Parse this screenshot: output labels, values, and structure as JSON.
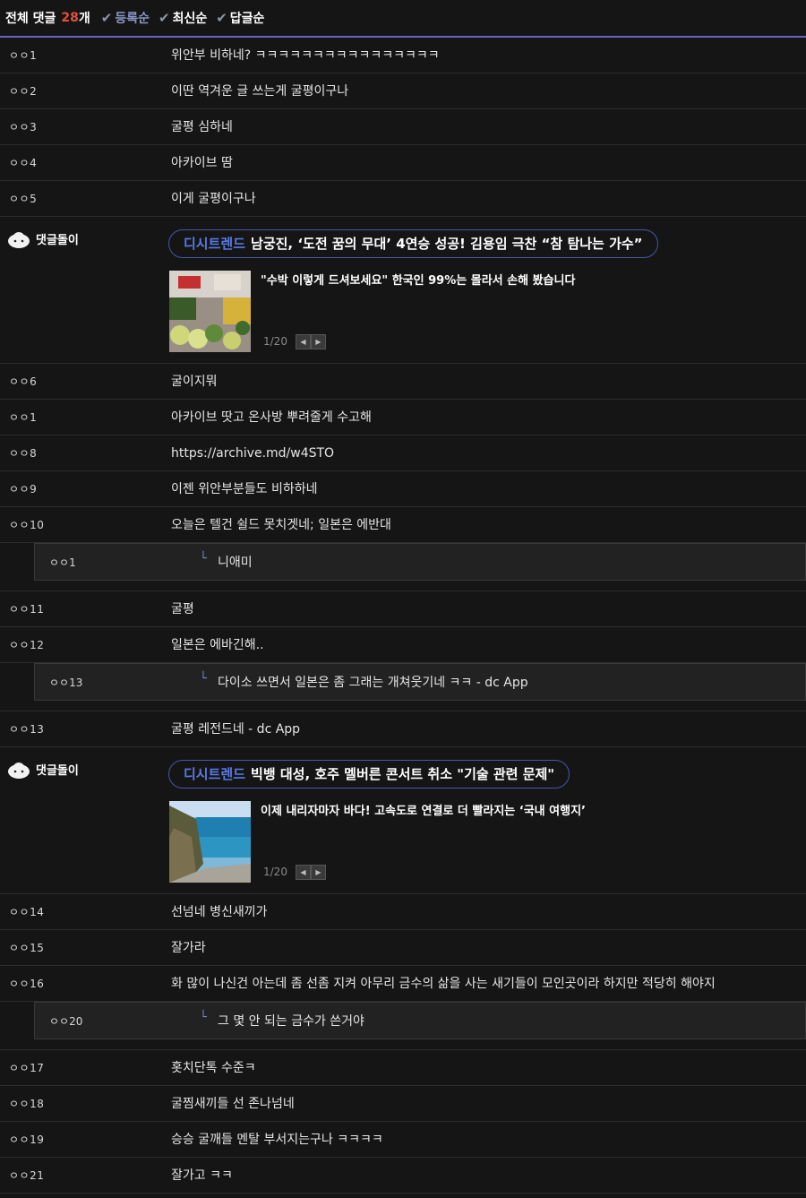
{
  "header": {
    "title": "전체 댓글",
    "count": "28",
    "count_unit": "개",
    "sorts": [
      {
        "label": "등록순",
        "active": true
      },
      {
        "label": "최신순",
        "active": false
      },
      {
        "label": "답글순",
        "active": false
      }
    ]
  },
  "comments": {
    "c1": {
      "nick": "ㅇㅇ1",
      "text": "위안부 비하네? ㅋㅋㅋㅋㅋㅋㅋㅋㅋㅋㅋㅋㅋㅋㅋㅋ"
    },
    "c2": {
      "nick": "ㅇㅇ2",
      "text": "이딴 역겨운 글 쓰는게 굴평이구나"
    },
    "c3": {
      "nick": "ㅇㅇ3",
      "text": "굴평 심하네"
    },
    "c4": {
      "nick": "ㅇㅇ4",
      "text": "아카이브 땀"
    },
    "c5": {
      "nick": "ㅇㅇ5",
      "text": "이게 굴평이구나"
    },
    "c6": {
      "nick": "ㅇㅇ6",
      "text": "굴이지뭐"
    },
    "c7": {
      "nick": "ㅇㅇ1",
      "text": "아카이브 땃고 온사방 뿌려줄게 수고해"
    },
    "c8": {
      "nick": "ㅇㅇ8",
      "text": "https://archive.md/w4STO"
    },
    "c9": {
      "nick": "ㅇㅇ9",
      "text": "이젠 위안부분들도 비하하네"
    },
    "c10": {
      "nick": "ㅇㅇ10",
      "text": "오늘은 텔건 쉴드 못치겟네; 일본은 에반대"
    },
    "r1": {
      "nick": "ㅇㅇ1",
      "text": "니애미"
    },
    "c11": {
      "nick": "ㅇㅇ11",
      "text": "굴평"
    },
    "c12": {
      "nick": "ㅇㅇ12",
      "text": "일본은 에바긴해.."
    },
    "r2": {
      "nick": "ㅇㅇ13",
      "text": "다이소 쓰면서 일본은 좀 그래는 개쳐웃기네 ㅋㅋ - dc App"
    },
    "c13": {
      "nick": "ㅇㅇ13",
      "text": "굴평 레전드네 - dc App"
    },
    "c14": {
      "nick": "ㅇㅇ14",
      "text": "선넘네 병신새끼가"
    },
    "c15": {
      "nick": "ㅇㅇ15",
      "text": "잘가라"
    },
    "c16": {
      "nick": "ㅇㅇ16",
      "text": "화 많이 나신건 아는데 좀 선좀 지켜 아무리 금수의 삶을 사는 새기들이 모인곳이라 하지만 적당히 해야지"
    },
    "r3": {
      "nick": "ㅇㅇ20",
      "text": "그 몇 안 되는 금수가 쓴거야"
    },
    "c17": {
      "nick": "ㅇㅇ17",
      "text": "홋치단톡 수준ㅋ"
    },
    "c18": {
      "nick": "ㅇㅇ18",
      "text": "굴찜새끼들 선 존나넘네"
    },
    "c19": {
      "nick": "ㅇㅇ19",
      "text": "승승 굴깨들 멘탈 부서지는구나 ㅋㅋㅋㅋ"
    },
    "c21": {
      "nick": "ㅇㅇ21",
      "text": "잘가고 ㅋㅋ"
    }
  },
  "bots": {
    "b1": {
      "name": "댓글돌이",
      "brand": "디시트렌드",
      "headline": "남궁진, ‘도전 꿈의 무대’ 4연승 성공! 김용임 극찬 “참 탐나는 가수”",
      "news": "\"수박 이렇게 드셔보세요\" 한국인 99%는 몰라서 손해 봤습니다",
      "page": "1/20"
    },
    "b2": {
      "name": "댓글돌이",
      "brand": "디시트렌드",
      "headline": "빅뱅 대성, 호주 멜버른 콘서트 취소 \"기술 관련 문제\"",
      "news": "이제 내리자마자 바다! 고속도로 연결로 더 빨라지는 ‘국내 여행지’",
      "page": "1/20"
    }
  },
  "icons": {
    "check": "check-icon",
    "reply_arrow": "reply-arrow-icon",
    "prev": "prev-icon",
    "next": "next-icon"
  },
  "colors": {
    "background": "#151515",
    "accent": "#6a5fc4",
    "count": "#e0503a",
    "brand": "#5a7be6"
  }
}
